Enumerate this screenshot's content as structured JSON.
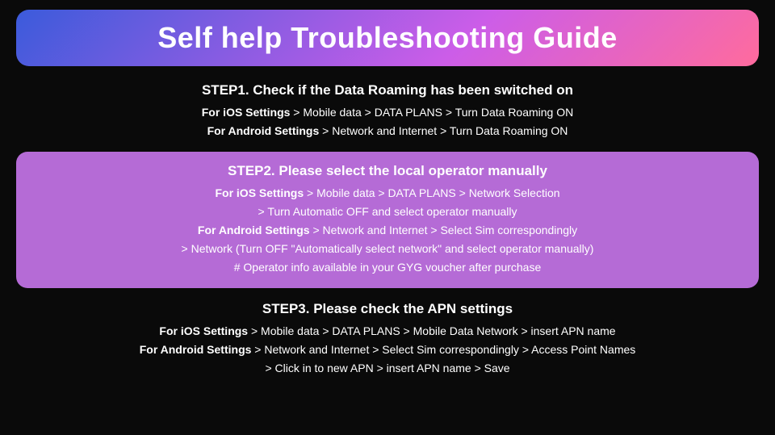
{
  "title": "Self help Troubleshooting Guide",
  "step1": {
    "title": "STEP1. Check if the Data Roaming has been switched on",
    "line1_bold": "For iOS Settings",
    "line1_rest": " > Mobile data > DATA PLANS > Turn Data Roaming ON",
    "line2_bold": "For Android Settings",
    "line2_rest": " > Network and Internet > Turn Data Roaming ON"
  },
  "step2": {
    "title": "STEP2. Please select the local operator manually",
    "line1_bold": "For iOS Settings",
    "line1_rest": " > Mobile data > DATA PLANS > Network Selection",
    "line2": "> Turn Automatic OFF and select operator manually",
    "line3_bold": "For Android Settings",
    "line3_rest": " > Network and Internet > Select Sim correspondingly",
    "line4": "> Network (Turn OFF \"Automatically select network\" and select operator manually)",
    "line5": "# Operator info available in your GYG voucher after purchase"
  },
  "step3": {
    "title": "STEP3. Please check the APN settings",
    "line1_bold": "For iOS Settings",
    "line1_rest": " > Mobile data > DATA PLANS > Mobile Data Network > insert APN name",
    "line2_bold": "For Android Settings",
    "line2_rest": " > Network and Internet > Select Sim correspondingly > Access Point Names",
    "line3": "> Click in to new APN > insert APN name > Save"
  }
}
